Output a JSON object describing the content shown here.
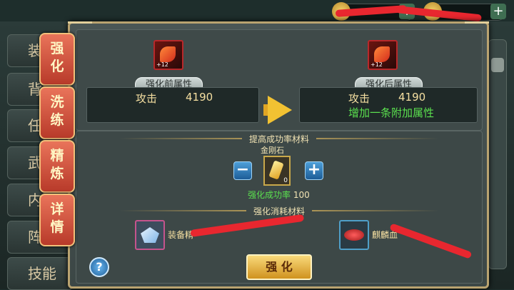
{
  "background_tabs": [
    "装",
    "背",
    "任",
    "武",
    "内",
    "阵",
    "技能"
  ],
  "side_tabs": [
    {
      "label": "强化",
      "active": true
    },
    {
      "label": "洗练",
      "active": false
    },
    {
      "label": "精炼",
      "active": false
    },
    {
      "label": "详情",
      "active": false
    }
  ],
  "top_bar": {
    "add_label": "+"
  },
  "before": {
    "title": "强化前属性",
    "equip_level": "+12",
    "stat_name": "攻击",
    "stat_value": "4190"
  },
  "after": {
    "title": "强化后属性",
    "equip_level": "+12",
    "stat_name": "攻击",
    "stat_value": "4190",
    "extra": "增加一条附加属性"
  },
  "success_section": {
    "title": "提高成功率材料",
    "material_name": "金刚石",
    "material_count": "0",
    "minus_label": "−",
    "plus_label": "+",
    "rate_label": "强化成功率",
    "rate_value": "100"
  },
  "cost_section": {
    "title": "强化消耗材料",
    "materials": [
      {
        "name": "装备精"
      },
      {
        "name": "麒麟血"
      }
    ]
  },
  "help_label": "?",
  "confirm_button": "强 化",
  "colors": {
    "accent_gold": "#c9a84a",
    "green_text": "#5be04f",
    "tab_red": "#b83a2a"
  }
}
